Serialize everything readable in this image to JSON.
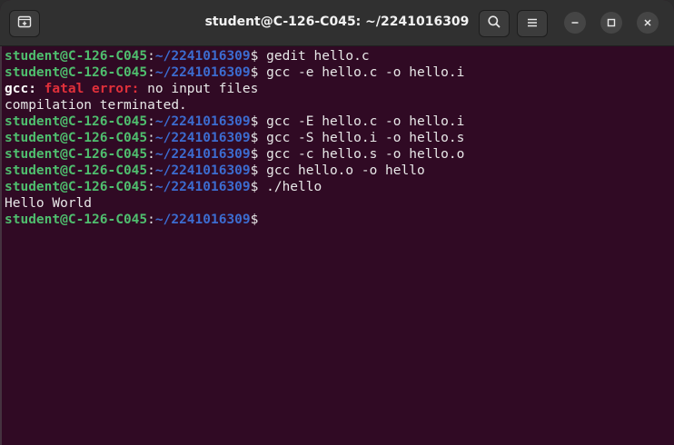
{
  "window": {
    "title": "student@C-126-C045: ~/2241016309"
  },
  "prompt": {
    "user_host": "student@C-126-C045",
    "separator": ":",
    "path": "~/2241016309",
    "symbol": "$"
  },
  "lines": [
    {
      "type": "cmd",
      "text": " gedit hello.c"
    },
    {
      "type": "cmd",
      "text": " gcc -e hello.c -o hello.i"
    },
    {
      "type": "error",
      "prefix": "gcc:",
      "label": "fatal error:",
      "text": " no input files"
    },
    {
      "type": "out",
      "text": "compilation terminated."
    },
    {
      "type": "cmd",
      "text": " gcc -E hello.c -o hello.i"
    },
    {
      "type": "cmd",
      "text": " gcc -S hello.i -o hello.s"
    },
    {
      "type": "cmd",
      "text": " gcc -c hello.s -o hello.o"
    },
    {
      "type": "cmd",
      "text": " gcc hello.o -o hello"
    },
    {
      "type": "cmd",
      "text": " ./hello"
    },
    {
      "type": "out",
      "text": "Hello World"
    },
    {
      "type": "cmd",
      "text": ""
    }
  ],
  "icons": {
    "new_tab": "new-tab-icon",
    "search": "search-icon",
    "menu": "hamburger-menu-icon",
    "minimize": "minimize-icon",
    "maximize": "maximize-icon",
    "close": "close-icon"
  },
  "colors": {
    "background": "#300a24",
    "user_host": "#4fbe6e",
    "path": "#3c6cd0",
    "error": "#e0303a",
    "titlebar": "#303030"
  }
}
